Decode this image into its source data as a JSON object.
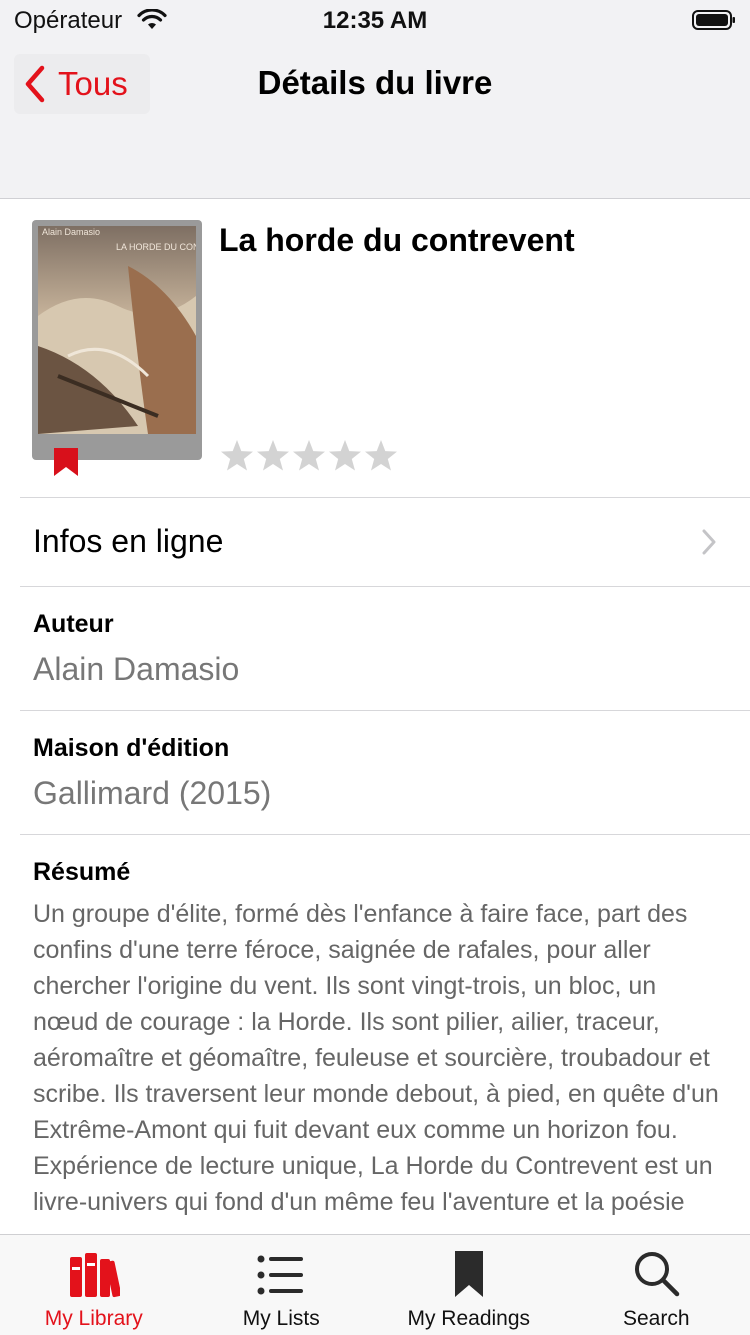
{
  "status_bar": {
    "carrier": "Opérateur",
    "time": "12:35 AM"
  },
  "nav": {
    "back_label": "Tous",
    "title": "Détails du livre"
  },
  "book": {
    "title": "La horde du contrevent",
    "cover_text_author": "Alain Damasio",
    "cover_text_title": "LA HORDE DU CONTREVENT",
    "rating": 0,
    "rating_max": 5
  },
  "online_info": {
    "label": "Infos en ligne"
  },
  "fields": {
    "author_label": "Auteur",
    "author_value": "Alain Damasio",
    "publisher_label": "Maison d'édition",
    "publisher_value": "Gallimard (2015)",
    "summary_label": "Résumé",
    "summary_text": "Un groupe d'élite, formé dès l'enfance à faire face, part des confins d'une terre féroce, saignée de rafales, pour aller chercher l'origine du vent. Ils sont vingt-trois, un bloc, un nœud de courage : la Horde. Ils sont pilier, ailier, traceur, aéromaître et géomaître, feuleuse et sourcière, troubadour et scribe. Ils traversent leur monde debout, à pied, en quête d'un Extrême-Amont qui fuit devant eux comme un horizon fou. Expérience de lecture unique, La Horde du Contrevent est un livre-univers qui fond d'un même feu l'aventure et la poésie"
  },
  "tabs": [
    {
      "label": "My Library",
      "icon": "library-icon",
      "active": true
    },
    {
      "label": "My Lists",
      "icon": "list-icon",
      "active": false
    },
    {
      "label": "My Readings",
      "icon": "bookmark-icon",
      "active": false
    },
    {
      "label": "Search",
      "icon": "search-icon",
      "active": false
    }
  ],
  "colors": {
    "accent": "#e3121b",
    "nav_background": "#f2f2f4",
    "secondary_text": "#777777",
    "star_empty": "#d3d3d3"
  }
}
